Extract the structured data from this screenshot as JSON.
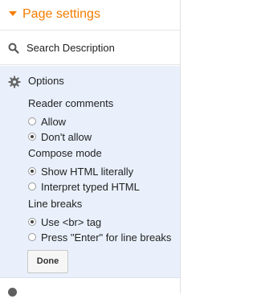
{
  "header": {
    "title": "Page settings",
    "accent": "#f57d00"
  },
  "search_description": {
    "label": "Search Description",
    "icon": "search-icon"
  },
  "options": {
    "title": "Options",
    "icon": "gear-icon",
    "background": "#e9f0fb",
    "groups": [
      {
        "label": "Reader comments",
        "choices": [
          {
            "label": "Allow",
            "checked": false
          },
          {
            "label": "Don't allow",
            "checked": true
          }
        ]
      },
      {
        "label": "Compose mode",
        "choices": [
          {
            "label": "Show HTML literally",
            "checked": true
          },
          {
            "label": "Interpret typed HTML",
            "checked": false
          }
        ]
      },
      {
        "label": "Line breaks",
        "choices": [
          {
            "label": "Use <br> tag",
            "checked": true
          },
          {
            "label": "Press \"Enter\" for line breaks",
            "checked": false
          }
        ]
      }
    ],
    "done_label": "Done"
  }
}
